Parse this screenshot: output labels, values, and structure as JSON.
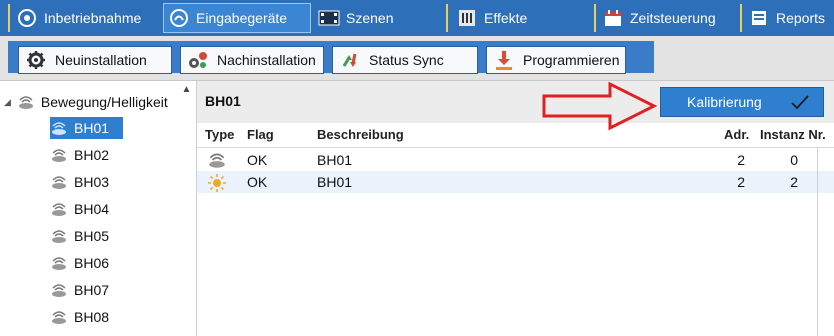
{
  "tabs": [
    {
      "label": "Inbetriebnahme",
      "icon": "target-icon",
      "active": false
    },
    {
      "label": "Eingabegeräte",
      "icon": "sensor-icon",
      "active": true
    },
    {
      "label": "Szenen",
      "icon": "film-icon",
      "active": false
    },
    {
      "label": "Effekte",
      "icon": "bars-icon",
      "active": false
    },
    {
      "label": "Zeitsteuerung",
      "icon": "calendar-icon",
      "active": false
    },
    {
      "label": "Reports",
      "icon": "report-icon",
      "active": false
    }
  ],
  "toolbar": {
    "buttons": [
      {
        "label": "Neuinstallation",
        "icon": "gear-icon"
      },
      {
        "label": "Nachinstallation",
        "icon": "gears-network-icon"
      },
      {
        "label": "Status Sync",
        "icon": "sync-arrows-icon"
      },
      {
        "label": "Programmieren",
        "icon": "download-arrow-icon"
      }
    ]
  },
  "tree": {
    "root": {
      "label": "Bewegung/Helligkeit",
      "icon": "motion-sensor-icon",
      "expanded": true
    },
    "children": [
      {
        "label": "BH01",
        "selected": true
      },
      {
        "label": "BH02",
        "selected": false
      },
      {
        "label": "BH03",
        "selected": false
      },
      {
        "label": "BH04",
        "selected": false
      },
      {
        "label": "BH05",
        "selected": false
      },
      {
        "label": "BH06",
        "selected": false
      },
      {
        "label": "BH07",
        "selected": false
      },
      {
        "label": "BH08",
        "selected": false
      }
    ]
  },
  "detail": {
    "title": "BH01",
    "calibrate_label": "Kalibrierung",
    "columns": [
      "Type",
      "Flag",
      "Beschreibung",
      "Adr.",
      "Instanz Nr."
    ],
    "rows": [
      {
        "type_icon": "motion-sensor-icon",
        "flag": "OK",
        "description": "BH01",
        "address": "2",
        "instance": "0"
      },
      {
        "type_icon": "sun-icon",
        "flag": "OK",
        "description": "BH01",
        "address": "2",
        "instance": "2"
      }
    ]
  },
  "colors": {
    "tab_bar": "#2d6fb8",
    "selection": "#2f7fd0",
    "annotation_arrow": "#e02020",
    "sun": "#f5a623"
  }
}
